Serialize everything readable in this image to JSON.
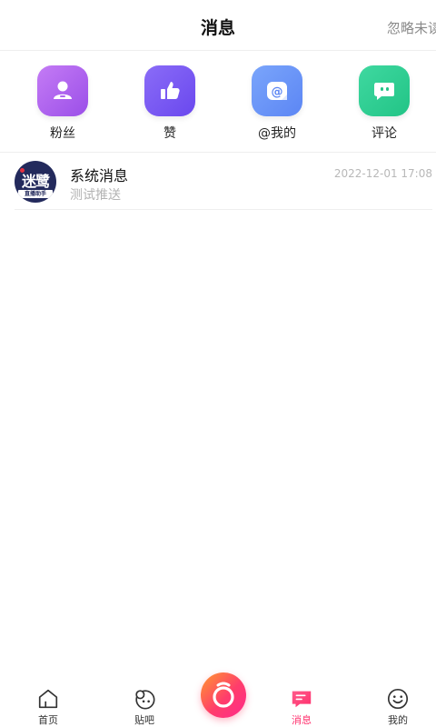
{
  "header": {
    "title": "消息",
    "action_label": "忽略未读"
  },
  "shortcuts": [
    {
      "label": "粉丝",
      "icon": "fans-icon",
      "color_from": "#c47bf5",
      "color_to": "#9b4fe8"
    },
    {
      "label": "赞",
      "icon": "thumbs-up-icon",
      "color_from": "#8a6cf7",
      "color_to": "#6a48ee"
    },
    {
      "label": "@我的",
      "icon": "at-mention-icon",
      "color_from": "#7aa5fb",
      "color_to": "#5c86f4"
    },
    {
      "label": "评论",
      "icon": "comment-icon",
      "color_from": "#3fd8a0",
      "color_to": "#22c486"
    }
  ],
  "messages": [
    {
      "title": "系统消息",
      "preview": "测试推送",
      "time": "2022-12-01 17:08",
      "avatar": {
        "text_top": "迷鹭",
        "text_bottom": "直播助手"
      }
    }
  ],
  "bottom_nav": {
    "items": [
      {
        "label": "首页",
        "icon": "home-icon",
        "active": false
      },
      {
        "label": "贴吧",
        "icon": "forum-icon",
        "active": false
      },
      {
        "label": "消息",
        "icon": "message-icon",
        "active": true
      },
      {
        "label": "我的",
        "icon": "smiley-profile-icon",
        "active": false
      }
    ],
    "center_icon": "live-camera-icon"
  },
  "colors": {
    "accent": "#ff2f6d",
    "muted_text": "#b3b3b3",
    "divider": "#eeeeee"
  }
}
